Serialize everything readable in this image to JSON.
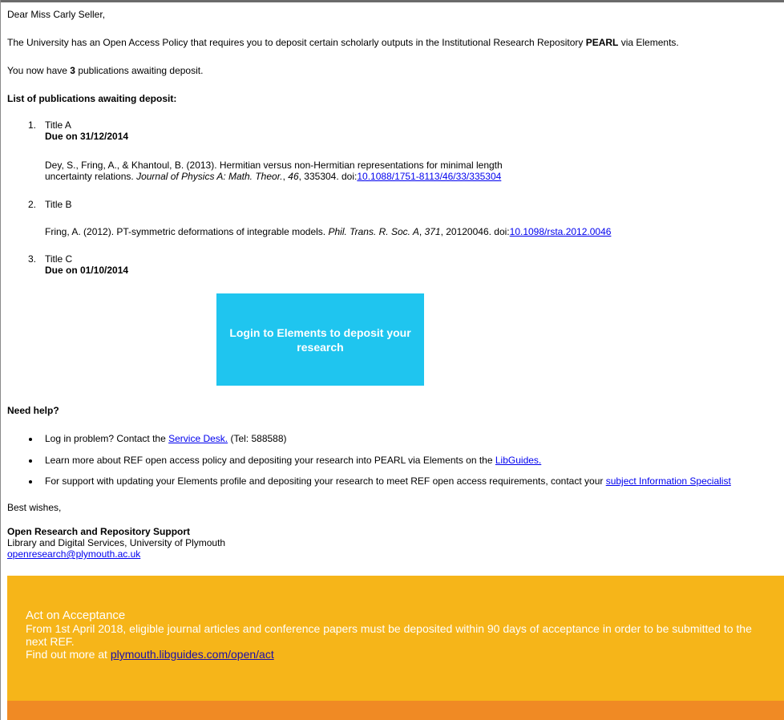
{
  "greeting": "Dear Miss Carly Seller,",
  "policy": {
    "prefix": "The University has an Open Access Policy that requires you to deposit certain scholarly outputs in the Institutional Research Repository ",
    "repo": "PEARL",
    "suffix": " via Elements."
  },
  "awaiting": {
    "prefix": "You now have ",
    "count": "3",
    "suffix": " publications awaiting deposit."
  },
  "list_heading": "List of publications awaiting deposit:",
  "publications": [
    {
      "num": "1.",
      "title": "Title A",
      "due": "Due on 31/12/2014",
      "cite_line1": "Dey, S., Fring, A., & Khantoul, B. (2013). Hermitian versus non-Hermitian representations for minimal length",
      "cite_line2_pre": "uncertainty relations. ",
      "journal": "Journal of Physics A: Math. Theor.",
      "sep1": ", ",
      "volume": "46",
      "rest": ", 335304. doi:",
      "doi": "10.1088/1751-8113/46/33/335304"
    },
    {
      "num": "2.",
      "title": "Title B",
      "cite_pre": "Fring, A. (2012). PT-symmetric deformations of integrable models. ",
      "journal": "Phil. Trans. R. Soc. A",
      "sep1": ", ",
      "volume": "371",
      "rest": ", 20120046. doi:",
      "doi": "10.1098/rsta.2012.0046"
    },
    {
      "num": "3.",
      "title": "Title C",
      "due": "Due on 01/10/2014"
    }
  ],
  "cta_label": "Login to Elements to deposit your research",
  "help": {
    "heading": "Need help?",
    "item1_pre": "Log in problem? Contact the ",
    "item1_link": "Service Desk.",
    "item1_post": " (Tel: 588588)",
    "item2_pre": "Learn more about REF open access policy and depositing your research into PEARL via Elements on the ",
    "item2_link": "LibGuides.",
    "item3_pre": "For support with updating your Elements profile and depositing your research to meet REF open access requirements, contact your ",
    "item3_link": "subject Information Specialist"
  },
  "closing": "Best wishes,",
  "signature": {
    "name": "Open Research and Repository Support",
    "dept": "Library and Digital Services, University of Plymouth",
    "email": "openresearch@plymouth.ac.uk"
  },
  "banner": {
    "title": "Act on Acceptance",
    "body": "From 1st April 2018, eligible journal articles and conference papers must be deposited within 90 days of acceptance in order to be submitted to the next REF.",
    "more_pre": "Find out more at ",
    "more_link": "plymouth.libguides.com/open/act"
  },
  "colors": {
    "cta": "#1fc5ef",
    "banner": "#f6b519",
    "strip": "#f08a24",
    "link": "#0000ee"
  }
}
